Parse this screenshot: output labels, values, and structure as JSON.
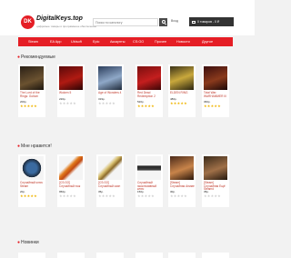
{
  "header": {
    "logo_letters": "DK",
    "logo_title": "DigitalKeys.top",
    "logo_subtitle": "цифровые товары и программное обеспечение",
    "search_placeholder": "Поиск по каталогу",
    "login_label": "Вход",
    "cart_label": "0 товаров - 0 ₽",
    "brand_color": "#e51e25"
  },
  "nav": [
    "Steam",
    "EA App",
    "Ubisoft",
    "Epic",
    "Аккаунты",
    "CS:GO",
    "Прочее",
    "Новости",
    "Другое"
  ],
  "sections": {
    "recommended": "Рекомендуемые",
    "liked": "Мне нравится!",
    "new": "Новинки"
  },
  "recommended": [
    {
      "name": "The Lord of the Rings: Gollum",
      "price": "200р.",
      "rating": 5
    },
    {
      "name": "Wolcen 5",
      "price": "220р.",
      "rating": 0
    },
    {
      "name": "Age of Wonders 4",
      "price": "319р.",
      "rating": 0
    },
    {
      "name": "Red Dead Redemption 2",
      "price": "520р.",
      "rating": 5
    },
    {
      "name": "ELDEN RING",
      "price": "480р.",
      "rating": 5
    },
    {
      "name": "Total War: WARHAMMER III",
      "price": "360р.",
      "rating": 5
    }
  ],
  "liked": [
    {
      "name": "Случайный ключ Steam",
      "price": "20р.",
      "rating": 5
    },
    {
      "name": "[CS:GO] Случайный нож",
      "price": "950р.",
      "rating": 0
    },
    {
      "name": "[CS:GO] Случайный скин",
      "price": "35р.",
      "rating": 0
    },
    {
      "name": "Случайный эксклюзивный ключ",
      "price": "150р.",
      "rating": 0
    },
    {
      "name": "[Steam] Случайная Аниме",
      "price": "30р.",
      "rating": 0
    },
    {
      "name": "[Steam] Случайная Ещё Steamd",
      "price": "35р.",
      "rating": 0
    }
  ]
}
